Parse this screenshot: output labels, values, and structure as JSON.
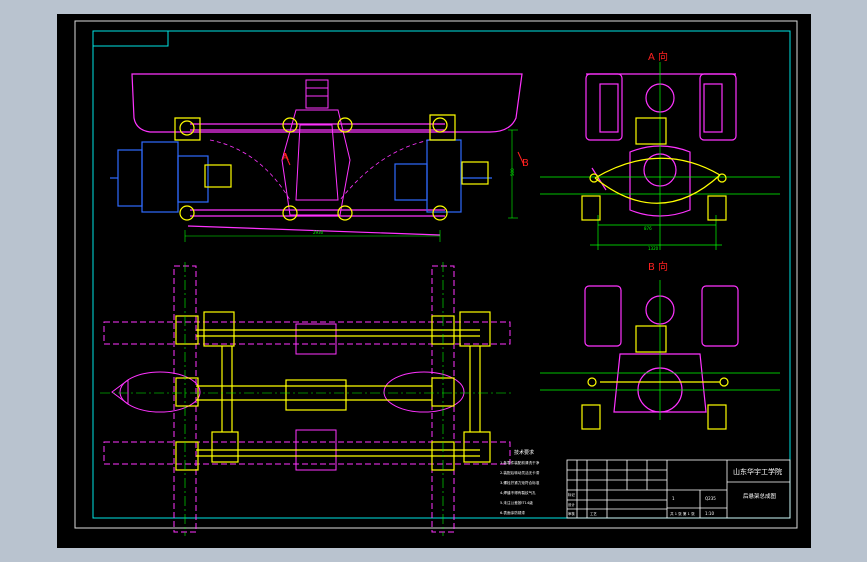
{
  "view_labels": {
    "view_a": "A 向",
    "view_b": "B 向",
    "marker_b": "B",
    "marker_a": "A"
  },
  "dimensions": {
    "top_width": "2930",
    "top_height": "500",
    "side_inner": "876",
    "side_outer": "1320"
  },
  "title_block": {
    "school": "山东华宇工学院",
    "drawing_name": "后悬架总成图",
    "material": "Q235",
    "scale": "1:10",
    "sheet": "共 1 张  第 1 张",
    "row_labels": [
      "标记",
      "设计",
      "审核",
      "工艺"
    ],
    "qty": "1"
  },
  "notes": {
    "heading": "技术要求",
    "lines": [
      "1.各零件装配前清洗干净",
      "2.装配后转动灵活无卡滞",
      "3.螺栓拧紧力矩符合标准",
      "4.焊缝不得有裂纹气孔",
      "5.未注公差按IT14级",
      "6.表面涂防锈漆"
    ]
  }
}
